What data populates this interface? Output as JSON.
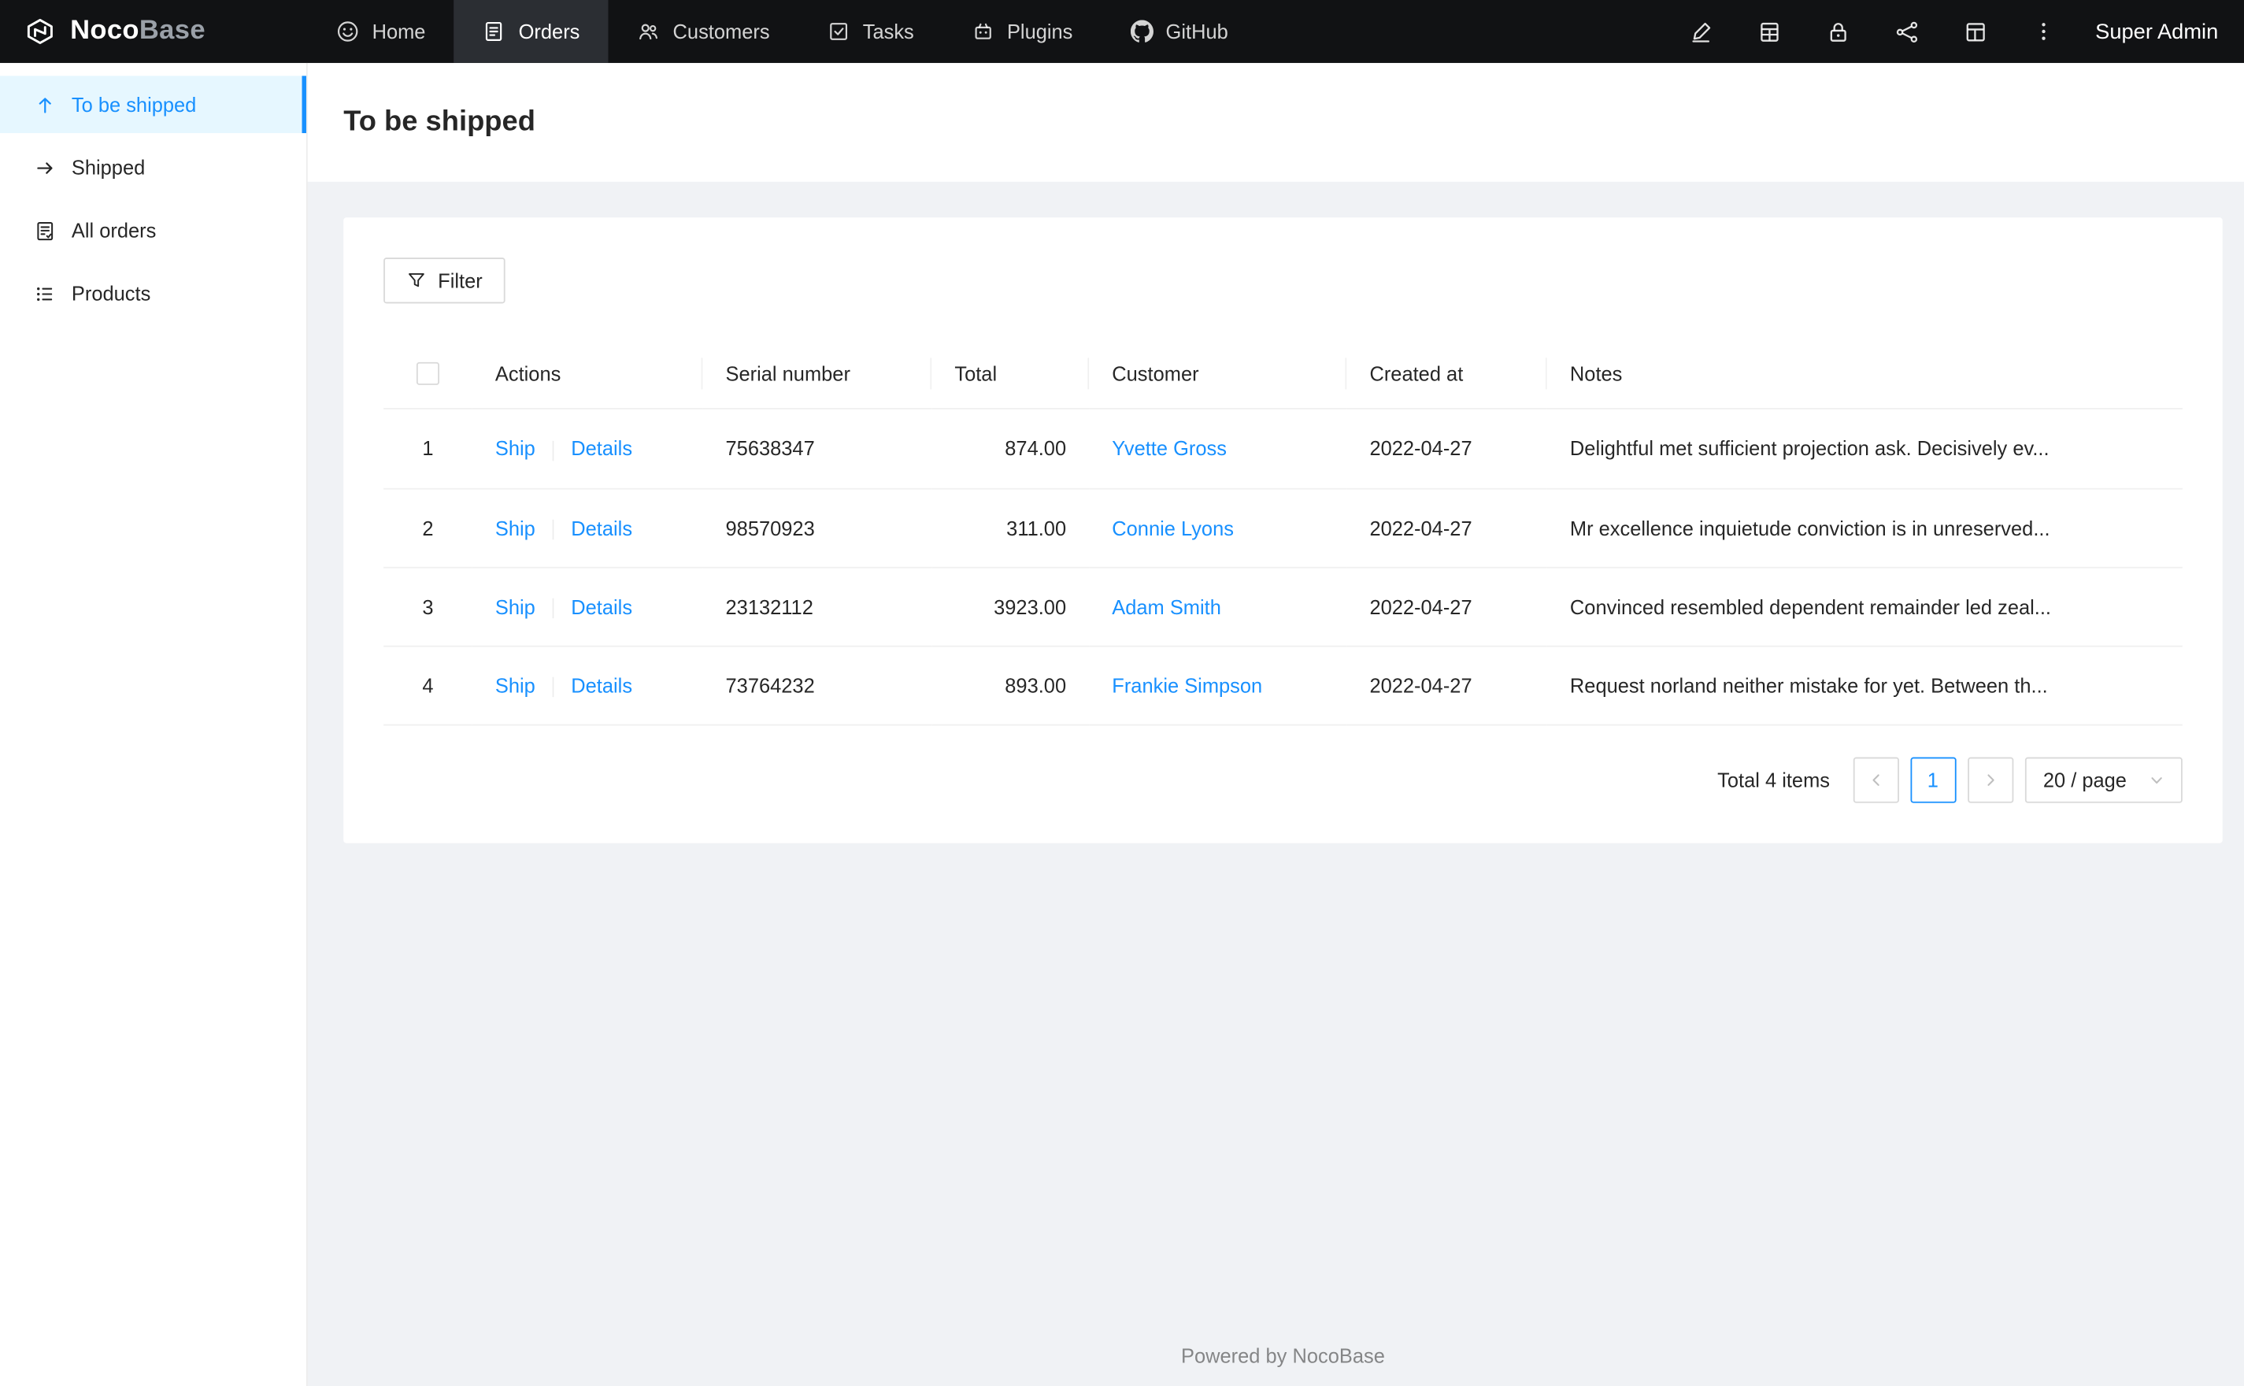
{
  "navbar": {
    "logo": {
      "noco": "Noco",
      "base": "Base"
    },
    "items": [
      {
        "label": "Home",
        "icon": "smile-icon",
        "active": false
      },
      {
        "label": "Orders",
        "icon": "orders-icon",
        "active": true
      },
      {
        "label": "Customers",
        "icon": "customers-icon",
        "active": false
      },
      {
        "label": "Tasks",
        "icon": "tasks-icon",
        "active": false
      },
      {
        "label": "Plugins",
        "icon": "plugins-icon",
        "active": false
      },
      {
        "label": "GitHub",
        "icon": "github-icon",
        "active": false
      }
    ],
    "right_icons": [
      "highlighter-icon",
      "collections-icon",
      "lock-icon",
      "api-icon",
      "templates-icon",
      "ellipsis-icon"
    ],
    "user": "Super Admin"
  },
  "sidebar": {
    "items": [
      {
        "label": "To be shipped",
        "icon": "arrow-up-icon",
        "active": true
      },
      {
        "label": "Shipped",
        "icon": "arrow-right-icon",
        "active": false
      },
      {
        "label": "All orders",
        "icon": "audit-icon",
        "active": false
      },
      {
        "label": "Products",
        "icon": "list-icon",
        "active": false
      }
    ]
  },
  "page": {
    "title": "To be shipped"
  },
  "toolbar": {
    "filter": "Filter"
  },
  "table": {
    "columns": {
      "actions": "Actions",
      "serial": "Serial number",
      "total": "Total",
      "customer": "Customer",
      "created": "Created at",
      "notes": "Notes"
    },
    "action_labels": {
      "ship": "Ship",
      "details": "Details"
    },
    "rows": [
      {
        "index": "1",
        "serial": "75638347",
        "total": "874.00",
        "customer": "Yvette Gross",
        "created": "2022-04-27",
        "notes": "Delightful met sufficient projection ask. Decisively ev..."
      },
      {
        "index": "2",
        "serial": "98570923",
        "total": "311.00",
        "customer": "Connie Lyons",
        "created": "2022-04-27",
        "notes": "Mr excellence inquietude conviction is in unreserved..."
      },
      {
        "index": "3",
        "serial": "23132112",
        "total": "3923.00",
        "customer": "Adam Smith",
        "created": "2022-04-27",
        "notes": "Convinced resembled dependent remainder led zeal..."
      },
      {
        "index": "4",
        "serial": "73764232",
        "total": "893.00",
        "customer": "Frankie Simpson",
        "created": "2022-04-27",
        "notes": "Request norland neither mistake for yet. Between th..."
      }
    ]
  },
  "pagination": {
    "total": "Total 4 items",
    "current_page": "1",
    "page_size": "20 / page"
  },
  "footer": {
    "text": "Powered by NocoBase"
  },
  "colors": {
    "accent": "#1890ff",
    "active_item_bg": "#e6f7ff",
    "navbar_bg": "#111214",
    "content_bg": "#f0f2f5"
  }
}
